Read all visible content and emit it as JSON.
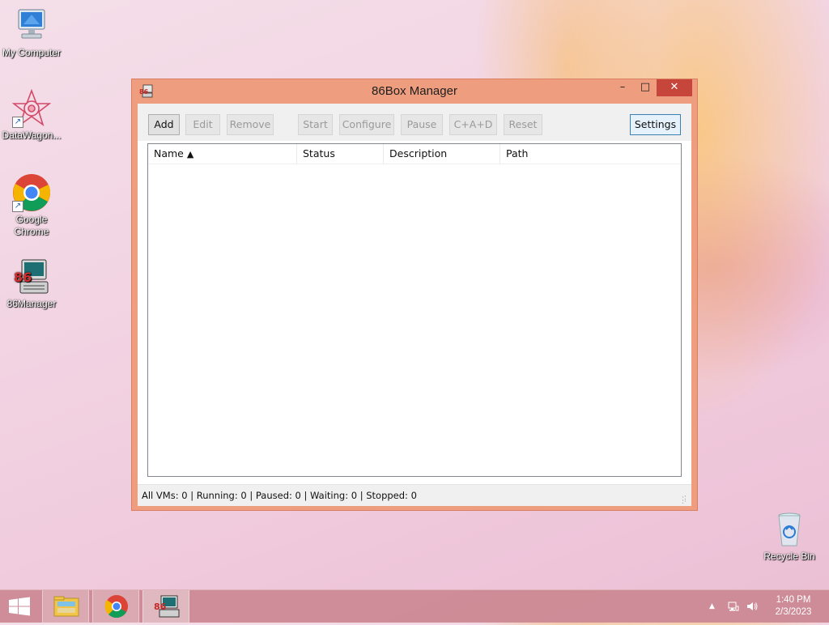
{
  "desktop": {
    "icons": [
      {
        "label": "My Computer",
        "icon": "computer-icon"
      },
      {
        "label": "DataWagon...",
        "icon": "datawagon-icon"
      },
      {
        "label": "Google Chrome",
        "icon": "chrome-icon"
      },
      {
        "label": "86Manager",
        "icon": "86box-icon"
      }
    ],
    "recycle_bin": {
      "label": "Recycle Bin",
      "icon": "recycle-bin-icon"
    }
  },
  "window": {
    "title": "86Box Manager",
    "controls": {
      "minimize": "–",
      "maximize": "□",
      "close": "✕"
    },
    "toolbar": {
      "add": "Add",
      "edit": "Edit",
      "remove": "Remove",
      "start": "Start",
      "configure": "Configure",
      "pause": "Pause",
      "cad": "C+A+D",
      "reset": "Reset",
      "settings": "Settings"
    },
    "columns": {
      "name": "Name",
      "name_sort": "▲",
      "status": "Status",
      "description": "Description",
      "path": "Path"
    },
    "rows": [],
    "status_bar": "All VMs: 0 | Running: 0 | Paused: 0 | Waiting: 0 | Stopped: 0"
  },
  "taskbar": {
    "clock": {
      "time": "1:40 PM",
      "date": "2/3/2023"
    },
    "tray": {
      "show_hidden": "▲"
    }
  },
  "colors": {
    "window_frame": "#ee9e7e",
    "close_button": "#c7463c",
    "focused_button_border": "#3c7fb1"
  }
}
